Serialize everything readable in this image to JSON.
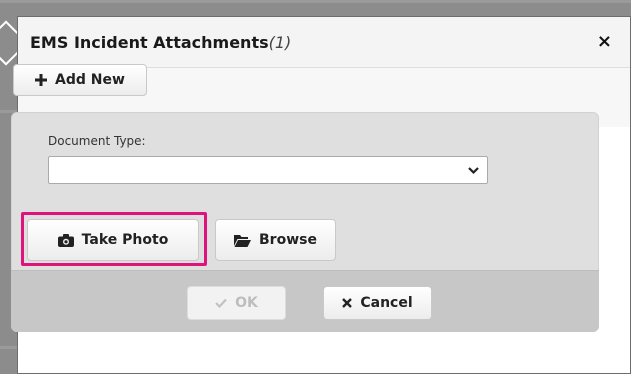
{
  "dialog": {
    "title": "EMS Incident Attachments",
    "count": "(1)",
    "close_glyph": "×"
  },
  "toolbar": {
    "add_new_label": "Add New",
    "add_icon": "plus-icon"
  },
  "form": {
    "document_type_label": "Document Type:",
    "document_type_value": "",
    "take_photo_label": "Take Photo",
    "take_photo_icon": "camera-icon",
    "browse_label": "Browse",
    "browse_icon": "folder-open-icon"
  },
  "footer": {
    "ok_label": "OK",
    "ok_icon": "check-icon",
    "cancel_label": "Cancel",
    "cancel_icon": "x-icon"
  },
  "colors": {
    "highlight": "#e0137c",
    "panel": "#dfdfdf",
    "footer": "#c7c7c7"
  }
}
